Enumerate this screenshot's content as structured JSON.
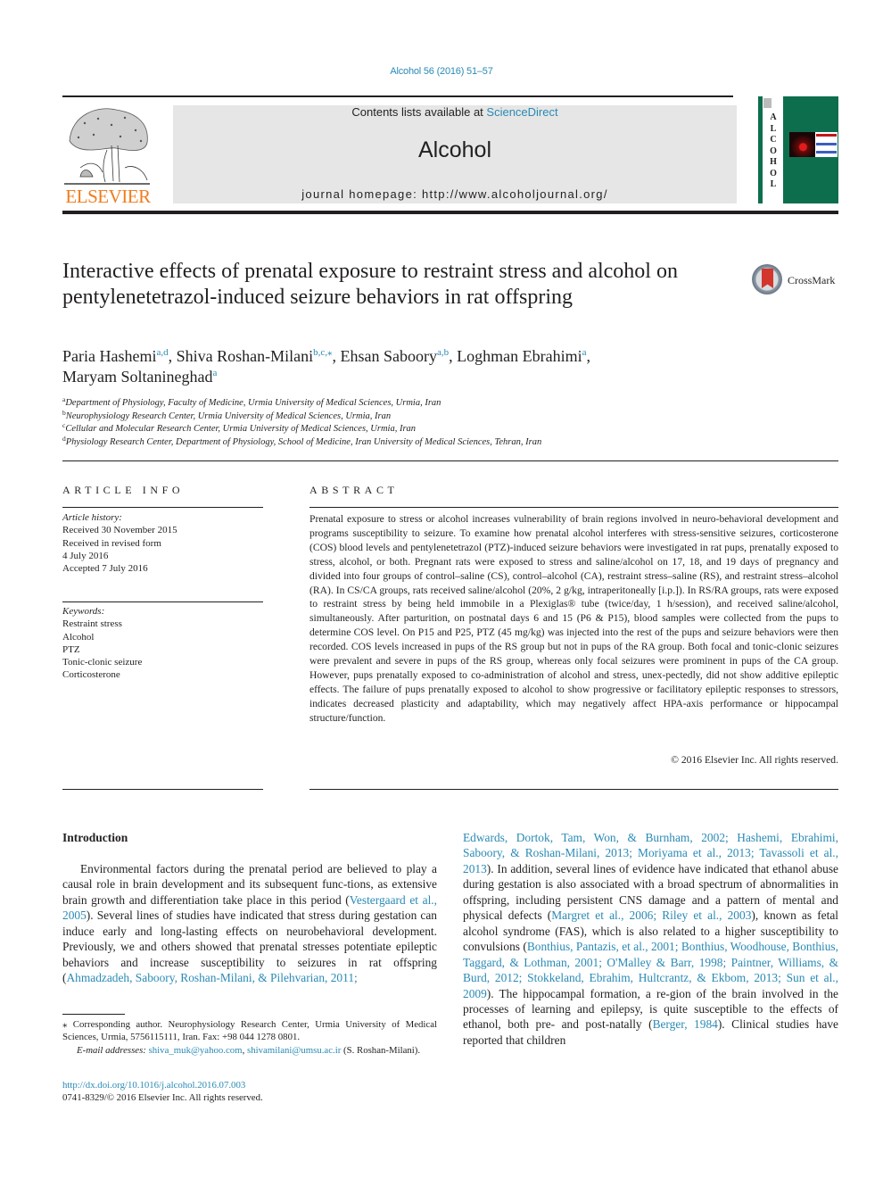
{
  "header": {
    "journal_ref": "Alcohol 56 (2016) 51–57",
    "contents_prefix": "Contents lists available at ",
    "contents_link": "ScienceDirect",
    "journal_name": "Alcohol",
    "homepage_prefix": "journal homepage: ",
    "homepage_url": "http://www.alcoholjournal.org/",
    "publisher_logo": "ELSEVIER",
    "cover_spine_letters": [
      "A",
      "L",
      "C",
      "O",
      "H",
      "O",
      "L"
    ],
    "publisher_color": "#f07c1d",
    "link_color": "#2a8ab5",
    "cover_color": "#0d6e4e"
  },
  "article": {
    "title": "Interactive effects of prenatal exposure to restraint stress and alcohol on pentylenetetrazol-induced seizure behaviors in rat offspring",
    "crossmark_label": "CrossMark",
    "authors": [
      {
        "name": "Paria Hashemi",
        "sup": "a,d",
        "sep": ", "
      },
      {
        "name": "Shiva Roshan-Milani",
        "sup": "b,c,⁎",
        "sep": ", "
      },
      {
        "name": "Ehsan Saboory",
        "sup": "a,b",
        "sep": ", "
      },
      {
        "name": "Loghman Ebrahimi",
        "sup": "a",
        "sep": ","
      },
      {
        "name": "Maryam Soltanineghad",
        "sup": "a",
        "sep": ""
      }
    ],
    "affiliations": [
      {
        "key": "a",
        "text": "Department of Physiology, Faculty of Medicine, Urmia University of Medical Sciences, Urmia, Iran"
      },
      {
        "key": "b",
        "text": "Neurophysiology Research Center, Urmia University of Medical Sciences, Urmia, Iran"
      },
      {
        "key": "c",
        "text": "Cellular and Molecular Research Center, Urmia University of Medical Sciences, Urmia, Iran"
      },
      {
        "key": "d",
        "text": "Physiology Research Center, Department of Physiology, School of Medicine, Iran University of Medical Sciences, Tehran, Iran"
      }
    ]
  },
  "article_info": {
    "heading": "Article info",
    "history_label": "Article history:",
    "history": [
      "Received 30 November 2015",
      "Received in revised form",
      "4 July 2016",
      "Accepted 7 July 2016"
    ],
    "keywords_label": "Keywords:",
    "keywords": [
      "Restraint stress",
      "Alcohol",
      "PTZ",
      "Tonic-clonic seizure",
      "Corticosterone"
    ]
  },
  "abstract": {
    "heading": "Abstract",
    "text": "Prenatal exposure to stress or alcohol increases vulnerability of brain regions involved in neuro-behavioral development and programs susceptibility to seizure. To examine how prenatal alcohol interferes with stress-sensitive seizures, corticosterone (COS) blood levels and pentylenetetrazol (PTZ)-induced seizure behaviors were investigated in rat pups, prenatally exposed to stress, alcohol, or both. Pregnant rats were exposed to stress and saline/alcohol on 17, 18, and 19 days of pregnancy and divided into four groups of control–saline (CS), control–alcohol (CA), restraint stress–saline (RS), and restraint stress–alcohol (RA). In CS/CA groups, rats received saline/alcohol (20%, 2 g/kg, intraperitoneally [i.p.]). In RS/RA groups, rats were exposed to restraint stress by being held immobile in a Plexiglas® tube (twice/day, 1 h/session), and received saline/alcohol, simultaneously. After parturition, on postnatal days 6 and 15 (P6 & P15), blood samples were collected from the pups to determine COS level. On P15 and P25, PTZ (45 mg/kg) was injected into the rest of the pups and seizure behaviors were then recorded. COS levels increased in pups of the RS group but not in pups of the RA group. Both focal and tonic-clonic seizures were prevalent and severe in pups of the RS group, whereas only focal seizures were prominent in pups of the CA group. However, pups prenatally exposed to co-administration of alcohol and stress, unex-pectedly, did not show additive epileptic effects. The failure of pups prenatally exposed to alcohol to show progressive or facilitatory epileptic responses to stressors, indicates decreased plasticity and adaptability, which may negatively affect HPA-axis performance or hippocampal structure/function.",
    "copyright": "© 2016 Elsevier Inc. All rights reserved."
  },
  "introduction": {
    "heading": "Introduction",
    "left_segments": [
      {
        "t": "Environmental factors during the prenatal period are believed to play a causal role in brain development and its subsequent func-tions, as extensive brain growth and differentiation take place in this period (",
        "link": false
      },
      {
        "t": "Vestergaard et al., 2005",
        "link": true
      },
      {
        "t": "). Several lines of studies have indicated that stress during gestation can induce early and long-lasting effects on neurobehavioral development. Previously, we and others showed that prenatal stresses potentiate epileptic behaviors and increase susceptibility to seizures in rat offspring (",
        "link": false
      },
      {
        "t": "Ahmadzadeh, Saboory, Roshan-Milani, & Pilehvarian, 2011;",
        "link": true
      }
    ],
    "right_segments": [
      {
        "t": "Edwards, Dortok, Tam, Won, & Burnham, 2002; Hashemi, Ebrahimi, Saboory, & Roshan-Milani, 2013; Moriyama et al., 2013; Tavassoli et al., 2013",
        "link": true
      },
      {
        "t": "). In addition, several lines of evidence have indicated that ethanol abuse during gestation is also associated with a broad spectrum of abnormalities in offspring, including persistent CNS damage and a pattern of mental and physical defects (",
        "link": false
      },
      {
        "t": "Margret et al., 2006; Riley et al., 2003",
        "link": true
      },
      {
        "t": "), known as fetal alcohol syndrome (FAS), which is also related to a higher susceptibility to convulsions (",
        "link": false
      },
      {
        "t": "Bonthius, Pantazis, et al., 2001; Bonthius, Woodhouse, Bonthius, Taggard, & Lothman, 2001; O'Malley & Barr, 1998; Paintner, Williams, & Burd, 2012; Stokkeland, Ebrahim, Hultcrantz, & Ekbom, 2013; Sun et al., 2009",
        "link": true
      },
      {
        "t": "). The hippocampal formation, a re-gion of the brain involved in the processes of learning and epilepsy, is quite susceptible to the effects of ethanol, both pre- and post-natally (",
        "link": false
      },
      {
        "t": "Berger, 1984",
        "link": true
      },
      {
        "t": "). Clinical studies have reported that children",
        "link": false
      }
    ]
  },
  "footnote": {
    "corresponding": "⁎ Corresponding author. Neurophysiology Research Center, Urmia University of Medical Sciences, Urmia, 5756115111, Iran. Fax: +98 044 1278 0801.",
    "email_label": "E-mail addresses: ",
    "email_1": "shiva_muk@yahoo.com",
    "email_sep": ", ",
    "email_2": "shivamilani@umsu.ac.ir",
    "email_suffix": " (S. Roshan-Milani).",
    "doi": "http://dx.doi.org/10.1016/j.alcohol.2016.07.003",
    "issn": "0741-8329/© 2016 Elsevier Inc. All rights reserved."
  }
}
